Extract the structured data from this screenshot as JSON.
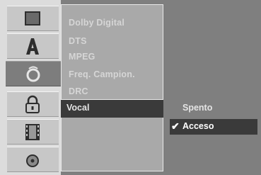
{
  "sidebar": {
    "icons": [
      {
        "name": "display-icon",
        "active": false
      },
      {
        "name": "language-icon",
        "active": false
      },
      {
        "name": "audio-icon",
        "active": true
      },
      {
        "name": "lock-icon",
        "active": false
      },
      {
        "name": "recording-icon",
        "active": false
      },
      {
        "name": "disc-icon",
        "active": false
      }
    ]
  },
  "menu": {
    "items": [
      "Dolby Digital",
      "DTS",
      "MPEG",
      "Freq. Campion.",
      "DRC"
    ],
    "selected": "Vocal"
  },
  "options": {
    "off": "Spento",
    "on": "Acceso",
    "check": "✔"
  }
}
